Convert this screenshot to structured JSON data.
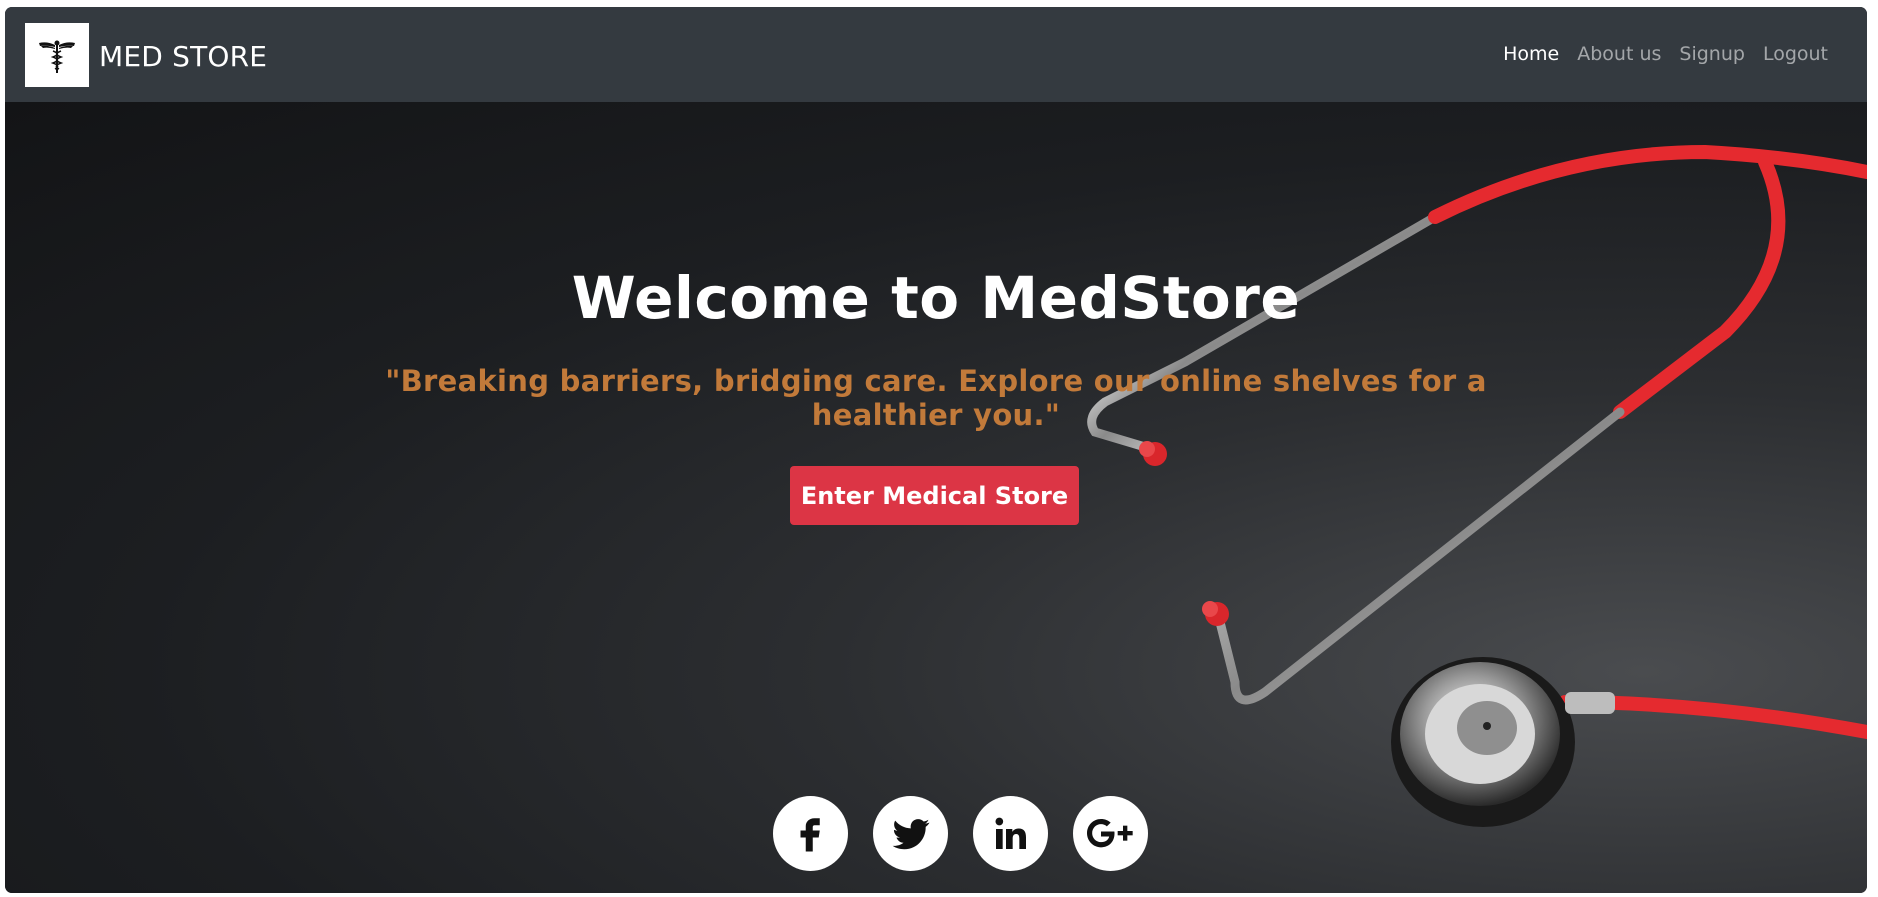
{
  "navbar": {
    "brand": "MED STORE",
    "links": [
      {
        "label": "Home"
      },
      {
        "label": "About us"
      },
      {
        "label": "Signup"
      },
      {
        "label": "Logout"
      }
    ]
  },
  "hero": {
    "title": "Welcome to MedStore",
    "subtitle": "\"Breaking barriers, bridging care. Explore our online shelves for a healthier you.\"",
    "cta_label": "Enter Medical Store"
  },
  "socials": [
    "facebook-icon",
    "twitter-icon",
    "linkedin-icon",
    "google-plus-icon"
  ],
  "colors": {
    "navbar_bg": "#343a40",
    "cta_bg": "#dc3545",
    "subtitle": "#c27a3a",
    "stethoscope_tube": "#e52a2f"
  }
}
